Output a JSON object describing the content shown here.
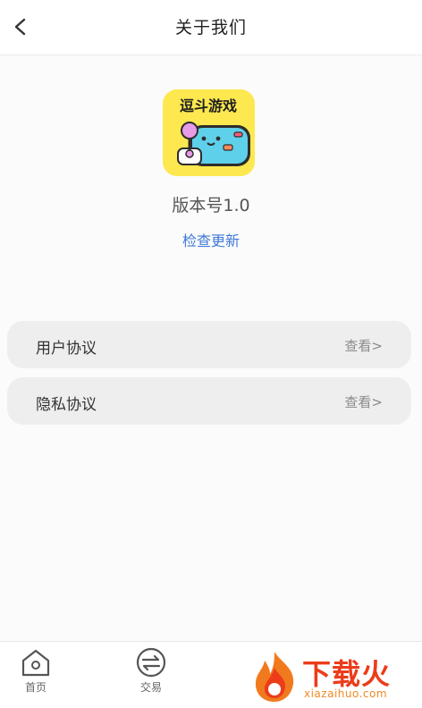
{
  "header": {
    "title": "关于我们"
  },
  "app": {
    "logo_text": "逗斗游戏",
    "version": "版本号1.0",
    "check_update": "检查更新"
  },
  "rows": [
    {
      "label": "用户协议",
      "action": "查看>"
    },
    {
      "label": "隐私协议",
      "action": "查看>"
    }
  ],
  "tabbar": [
    {
      "label": "首页",
      "icon": "home-icon"
    },
    {
      "label": "交易",
      "icon": "exchange-icon"
    }
  ],
  "watermark": {
    "cn": "下载火",
    "en": "xiazaihuo.com"
  },
  "colors": {
    "accent": "#3f79d8",
    "logo_bg": "#fde84f",
    "watermark": "#ec3c1a"
  }
}
